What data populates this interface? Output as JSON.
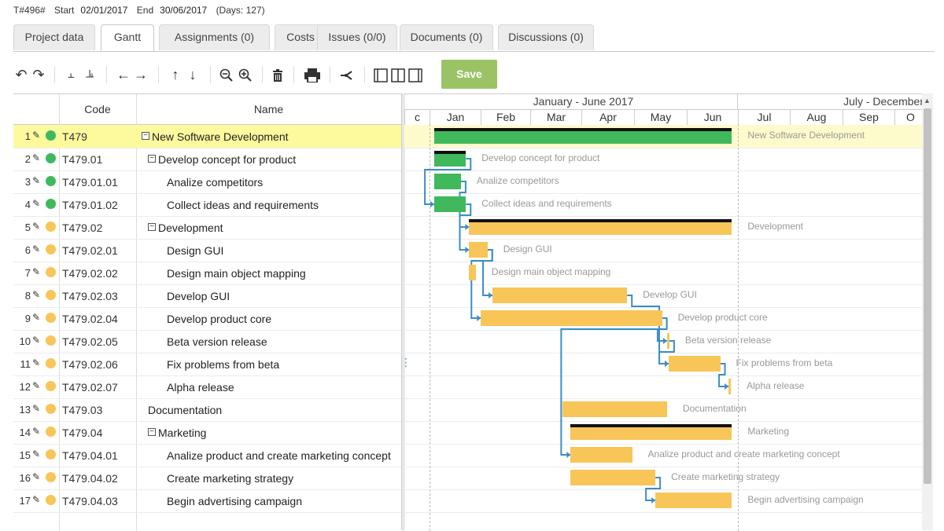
{
  "info": {
    "id": "T#496#",
    "start_label": "Start",
    "start": "02/01/2017",
    "end_label": "End",
    "end": "30/06/2017",
    "days": "(Days: 127)"
  },
  "tabs": [
    {
      "label": "Project data",
      "active": false
    },
    {
      "label": "Gantt",
      "active": true
    },
    {
      "label": "Assignments (0)",
      "active": false
    },
    {
      "label": "Costs",
      "active": false
    },
    {
      "label": "Issues (0/0)",
      "active": false
    },
    {
      "label": "Documents (0)",
      "active": false
    },
    {
      "label": "Discussions (0)",
      "active": false
    }
  ],
  "toolbar": {
    "icons": [
      "undo-icon",
      "redo-icon",
      "indent-icon",
      "outdent-icon",
      "move-left-icon",
      "move-right-icon",
      "move-up-icon",
      "move-down-icon",
      "zoom-out-icon",
      "zoom-in-icon",
      "delete-icon",
      "print-icon",
      "critical-path-icon",
      "full-grid-icon",
      "split-view-icon",
      "full-gantt-icon"
    ],
    "save_label": "Save"
  },
  "grid": {
    "headers": {
      "code": "Code",
      "name": "Name"
    },
    "rows": [
      {
        "num": "1",
        "status": "green",
        "code": "T479",
        "name": "New Software Development",
        "level": 0,
        "collapsible": true,
        "highlight": true
      },
      {
        "num": "2",
        "status": "green",
        "code": "T479.01",
        "name": "Develop concept for product",
        "level": 1,
        "collapsible": true
      },
      {
        "num": "3",
        "status": "green",
        "code": "T479.01.01",
        "name": "Analize competitors",
        "level": 2,
        "collapsible": false
      },
      {
        "num": "4",
        "status": "green",
        "code": "T479.01.02",
        "name": "Collect ideas and requirements",
        "level": 2,
        "collapsible": false
      },
      {
        "num": "5",
        "status": "orange",
        "code": "T479.02",
        "name": "Development",
        "level": 1,
        "collapsible": true
      },
      {
        "num": "6",
        "status": "orange",
        "code": "T479.02.01",
        "name": "Design GUI",
        "level": 2,
        "collapsible": false
      },
      {
        "num": "7",
        "status": "orange",
        "code": "T479.02.02",
        "name": "Design main object mapping",
        "level": 2,
        "collapsible": false
      },
      {
        "num": "8",
        "status": "orange",
        "code": "T479.02.03",
        "name": "Develop GUI",
        "level": 2,
        "collapsible": false
      },
      {
        "num": "9",
        "status": "orange",
        "code": "T479.02.04",
        "name": "Develop product core",
        "level": 2,
        "collapsible": false
      },
      {
        "num": "10",
        "status": "orange",
        "code": "T479.02.05",
        "name": "Beta version release",
        "level": 2,
        "collapsible": false
      },
      {
        "num": "11",
        "status": "orange",
        "code": "T479.02.06",
        "name": "Fix problems from beta",
        "level": 2,
        "collapsible": false
      },
      {
        "num": "12",
        "status": "orange",
        "code": "T479.02.07",
        "name": "Alpha release",
        "level": 2,
        "collapsible": false
      },
      {
        "num": "13",
        "status": "orange",
        "code": "T479.03",
        "name": "Documentation",
        "level": 1,
        "collapsible": false
      },
      {
        "num": "14",
        "status": "orange",
        "code": "T479.04",
        "name": "Marketing",
        "level": 1,
        "collapsible": true
      },
      {
        "num": "15",
        "status": "orange",
        "code": "T479.04.01",
        "name": "Analize product and create marketing concept",
        "level": 2,
        "collapsible": false
      },
      {
        "num": "16",
        "status": "orange",
        "code": "T479.04.02",
        "name": "Create marketing strategy",
        "level": 2,
        "collapsible": false
      },
      {
        "num": "17",
        "status": "orange",
        "code": "T479.04.03",
        "name": "Begin advertising campaign",
        "level": 2,
        "collapsible": false
      }
    ]
  },
  "gantt": {
    "periods": [
      "January - June 2017",
      "July - December"
    ],
    "months": [
      "c",
      "Jan",
      "Feb",
      "Mar",
      "Apr",
      "May",
      "Jun",
      "Jul",
      "Aug",
      "Sep",
      "O"
    ],
    "colors": {
      "green": "#3fb95c",
      "orange": "#f8c558",
      "link": "#3a8ec6",
      "highlight": "#fdfa9e"
    },
    "bars": [
      {
        "label": "New Software Development",
        "start": "2017-01-02",
        "end": "2017-06-30",
        "color": "green",
        "summary": true
      },
      {
        "label": "Develop concept for product",
        "start": "2017-01-02",
        "end": "2017-01-21",
        "color": "green",
        "summary": true
      },
      {
        "label": "Analize competitors",
        "start": "2017-01-02",
        "end": "2017-01-18",
        "color": "green",
        "summary": false
      },
      {
        "label": "Collect ideas and requirements",
        "start": "2017-01-02",
        "end": "2017-01-21",
        "color": "green",
        "summary": false
      },
      {
        "label": "Development",
        "start": "2017-01-23",
        "end": "2017-06-30",
        "color": "orange",
        "summary": true
      },
      {
        "label": "Design GUI",
        "start": "2017-01-23",
        "end": "2017-02-03",
        "color": "orange",
        "summary": false
      },
      {
        "label": "Design main object mapping",
        "start": "2017-01-23",
        "end": "2017-01-27",
        "color": "orange",
        "summary": false
      },
      {
        "label": "Develop GUI",
        "start": "2017-02-06",
        "end": "2017-04-28",
        "color": "orange",
        "summary": false
      },
      {
        "label": "Develop product core",
        "start": "2017-01-30",
        "end": "2017-05-19",
        "color": "orange",
        "summary": false
      },
      {
        "label": "Beta version release",
        "start": "2017-05-22",
        "end": "2017-05-23",
        "color": "orange",
        "summary": false
      },
      {
        "label": "Fix problems from beta",
        "start": "2017-05-23",
        "end": "2017-06-23",
        "color": "orange",
        "summary": false
      },
      {
        "label": "Alpha release",
        "start": "2017-06-28",
        "end": "2017-06-29",
        "color": "orange",
        "summary": false
      },
      {
        "label": "Documentation",
        "start": "2017-03-20",
        "end": "2017-05-22",
        "color": "orange",
        "summary": false
      },
      {
        "label": "Marketing",
        "start": "2017-03-25",
        "end": "2017-06-30",
        "color": "orange",
        "summary": true
      },
      {
        "label": "Analize product and create marketing concept",
        "start": "2017-03-25",
        "end": "2017-05-01",
        "color": "orange",
        "summary": false
      },
      {
        "label": "Create marketing strategy",
        "start": "2017-03-25",
        "end": "2017-05-15",
        "color": "orange",
        "summary": false
      },
      {
        "label": "Begin advertising campaign",
        "start": "2017-05-15",
        "end": "2017-06-30",
        "color": "orange",
        "summary": false
      }
    ],
    "links": [
      [
        1,
        3
      ],
      [
        2,
        5
      ],
      [
        3,
        4
      ],
      [
        5,
        7
      ],
      [
        5,
        8
      ],
      [
        7,
        10
      ],
      [
        8,
        9
      ],
      [
        9,
        10
      ],
      [
        10,
        11
      ],
      [
        8,
        14
      ],
      [
        15,
        16
      ]
    ]
  }
}
